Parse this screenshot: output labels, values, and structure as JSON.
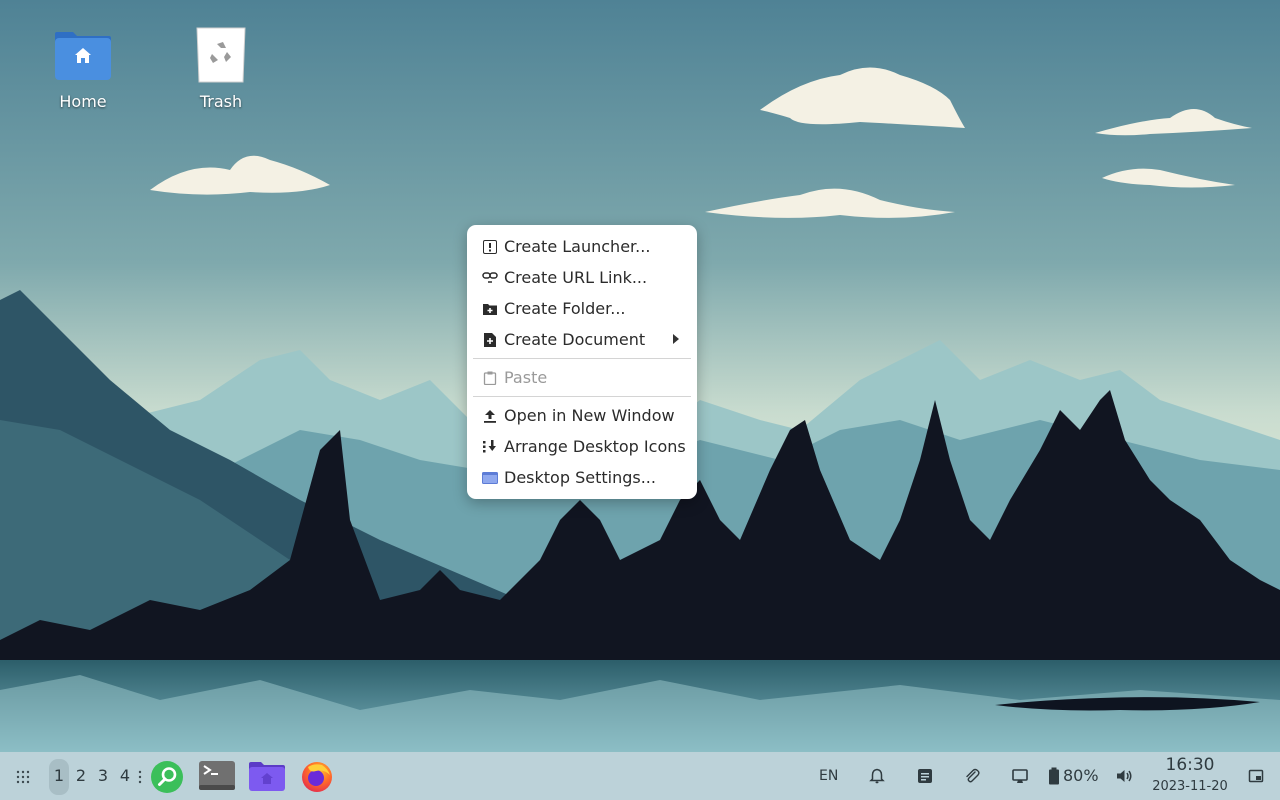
{
  "desktop": {
    "icons": [
      {
        "label": "Home"
      },
      {
        "label": "Trash"
      }
    ]
  },
  "context_menu": {
    "items": [
      {
        "label": "Create Launcher...",
        "icon": "launcher-icon"
      },
      {
        "label": "Create URL Link...",
        "icon": "link-icon"
      },
      {
        "label": "Create Folder...",
        "icon": "new-folder-icon"
      },
      {
        "label": "Create Document",
        "icon": "new-document-icon",
        "submenu": true
      },
      {
        "label": "Paste",
        "icon": "clipboard-icon",
        "disabled": true
      },
      {
        "label": "Open in New Window",
        "icon": "upload-icon"
      },
      {
        "label": "Arrange Desktop Icons",
        "icon": "arrange-icon"
      },
      {
        "label": "Desktop Settings...",
        "icon": "desktop-settings-icon"
      }
    ]
  },
  "taskbar": {
    "workspaces": [
      "1",
      "2",
      "3",
      "4"
    ],
    "active_workspace": "1",
    "apps": [
      "search-app-icon",
      "terminal-icon",
      "file-manager-icon",
      "firefox-icon"
    ],
    "tray": {
      "language": "EN",
      "battery": "80%"
    },
    "clock": {
      "time": "16:30",
      "date": "2023-11-20"
    }
  },
  "colors": {
    "taskbar_bg": "#bcd2d9",
    "menu_bg": "#ffffff",
    "folder_blue": "#4a8fe0",
    "search_green": "#3bbf5a"
  }
}
